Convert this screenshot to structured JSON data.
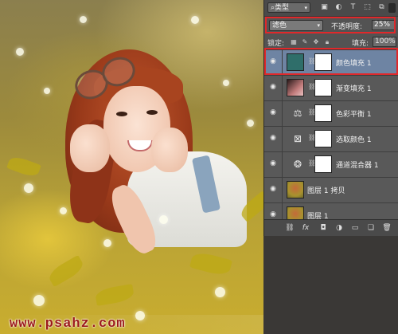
{
  "layers_panel": {
    "filter": {
      "kind_label": "类型"
    },
    "blend_mode": "滤色",
    "opacity_label": "不透明度:",
    "opacity_value": "25%",
    "lock_label": "锁定:",
    "fill_label": "填充:",
    "fill_value": "100%",
    "layers": [
      {
        "name": "颜色填充 1",
        "type": "color-fill",
        "selected": true,
        "thumb_color": "#2f6e6a"
      },
      {
        "name": "渐变填充 1",
        "type": "gradient-fill",
        "selected": false
      },
      {
        "name": "色彩平衡 1",
        "type": "color-balance",
        "selected": false
      },
      {
        "name": "选取颜色 1",
        "type": "selective-color",
        "selected": false
      },
      {
        "name": "通道混合器 1",
        "type": "channel-mixer",
        "selected": false
      },
      {
        "name": "图层 1 拷贝",
        "type": "pixel",
        "selected": false
      },
      {
        "name": "图层 1",
        "type": "pixel",
        "selected": false
      }
    ]
  },
  "watermark": "www.psahz.com",
  "colors": {
    "highlight_red": "#e0282a",
    "selected_layer": "#6e84a3",
    "panel_bg": "#535353"
  }
}
